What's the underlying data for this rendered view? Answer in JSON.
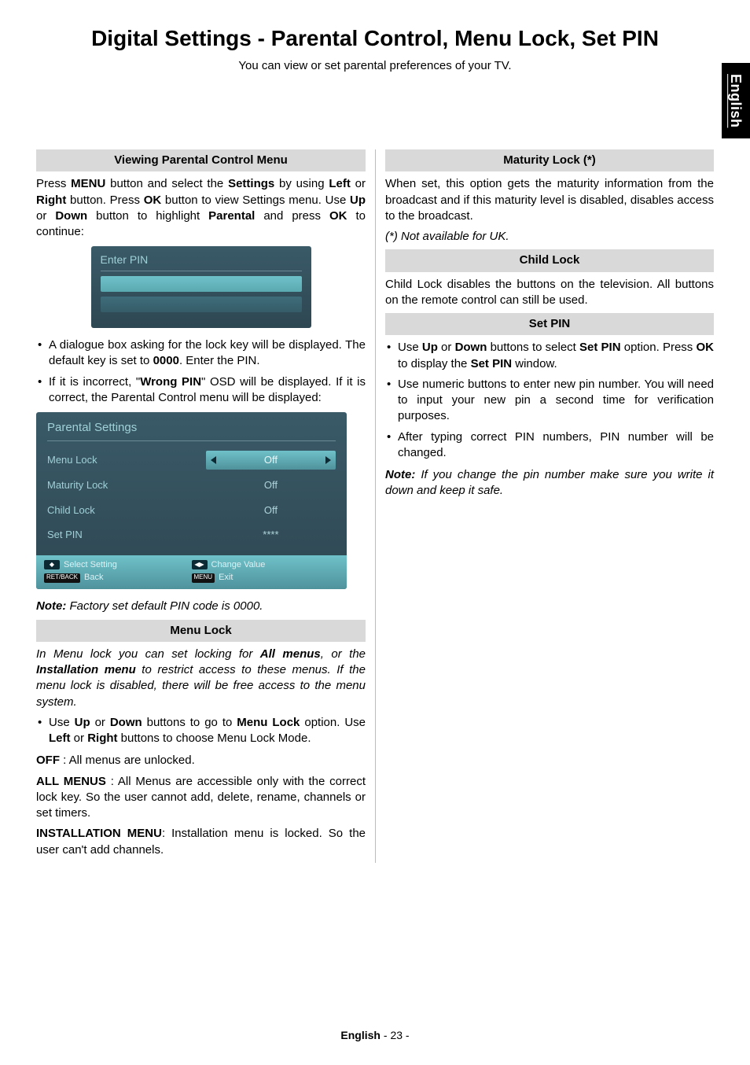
{
  "sideTab": "English",
  "title": "Digital Settings - Parental Control, Menu Lock, Set PIN",
  "subtitle": "You can view or set parental preferences of your TV.",
  "left": {
    "viewing": {
      "heading": "Viewing Parental Control Menu",
      "p1_a": "Press ",
      "p1_b": "MENU",
      "p1_c": " button and select the ",
      "p1_d": "Settings",
      "p1_e": " by using ",
      "p1_f": "Left",
      "p1_g": " or ",
      "p1_h": "Right",
      "p1_i": " button. Press ",
      "p1_j": "OK",
      "p1_k": " button to view Settings menu. Use ",
      "p1_l": "Up",
      "p1_m": " or ",
      "p1_n": "Down",
      "p1_o": " button to highlight ",
      "p1_p": "Parental",
      "p1_q": " and press ",
      "p1_r": "OK",
      "p1_s": " to continue:",
      "enterPinLabel": "Enter PIN",
      "b1_a": "A dialogue box asking for the lock key will be displayed. The default key is set to ",
      "b1_b": "0000",
      "b1_c": ". Enter the PIN.",
      "b2_a": "If it is incorrect, \"",
      "b2_b": "Wrong PIN",
      "b2_c": "\" OSD will be displayed. If it is correct, the Parental Control menu will be displayed:",
      "parental": {
        "title": "Parental Settings",
        "rows": [
          {
            "label": "Menu Lock",
            "value": "Off",
            "selected": true
          },
          {
            "label": "Maturity Lock",
            "value": "Off",
            "selected": false
          },
          {
            "label": "Child Lock",
            "value": "Off",
            "selected": false
          },
          {
            "label": "Set PIN",
            "value": "****",
            "selected": false
          }
        ],
        "footer": {
          "selectSetting": "Select Setting",
          "changeValue": "Change Value",
          "back": "Back",
          "exit": "Exit",
          "menuChip": "MENU",
          "retChip": "RET/BACK"
        }
      },
      "note_a": "Note:",
      "note_b": " Factory set default PIN code is 0000."
    },
    "menuLock": {
      "heading": "Menu Lock",
      "intro_a": "In Menu lock you can set locking for ",
      "intro_b": "All menus",
      "intro_c": ", or the ",
      "intro_d": "Installation menu",
      "intro_e": " to restrict access to these menus. If the menu lock is disabled, there will be free access to the menu system.",
      "b1_a": "Use ",
      "b1_b": "Up",
      "b1_c": " or ",
      "b1_d": "Down",
      "b1_e": " buttons to go to ",
      "b1_f": "Menu Lock",
      "b1_g": " option. Use ",
      "b1_h": "Left",
      "b1_i": " or ",
      "b1_j": "Right",
      "b1_k": " buttons to choose Menu Lock Mode.",
      "off_a": "OFF",
      "off_b": " : All menus are unlocked.",
      "all_a": "ALL MENUS",
      "all_b": " : All Menus are accessible only with the correct lock key. So the user cannot add, delete, rename, channels or set timers.",
      "inst_a": "INSTALLATION MENU",
      "inst_b": ": Installation menu is locked. So the user can't add channels."
    }
  },
  "right": {
    "maturity": {
      "heading": "Maturity Lock (*)",
      "p1": "When set, this option gets the maturity information from the broadcast and if this maturity level is disabled, disables access to the broadcast.",
      "note": "(*) Not available for UK."
    },
    "childLock": {
      "heading": "Child Lock",
      "p1": "Child Lock disables the buttons on the television. All buttons on the remote control can still be used."
    },
    "setPin": {
      "heading": "Set PIN",
      "b1_a": "Use ",
      "b1_b": "Up",
      "b1_c": " or ",
      "b1_d": "Down",
      "b1_e": " buttons to select ",
      "b1_f": "Set PIN",
      "b1_g": " option. Press ",
      "b1_h": "OK",
      "b1_i": " to display the ",
      "b1_j": "Set PIN",
      "b1_k": " window.",
      "b2": "Use numeric buttons to enter new pin number. You will need to input your new pin a second time for verification purposes.",
      "b3": "After typing correct PIN numbers, PIN number will be changed.",
      "note_a": "Note:",
      "note_b": " If you change the pin number make sure you write it down and keep it safe."
    }
  },
  "footer": {
    "langLabel": "English",
    "dash": "  - ",
    "page": "23",
    "dash2": " -"
  }
}
